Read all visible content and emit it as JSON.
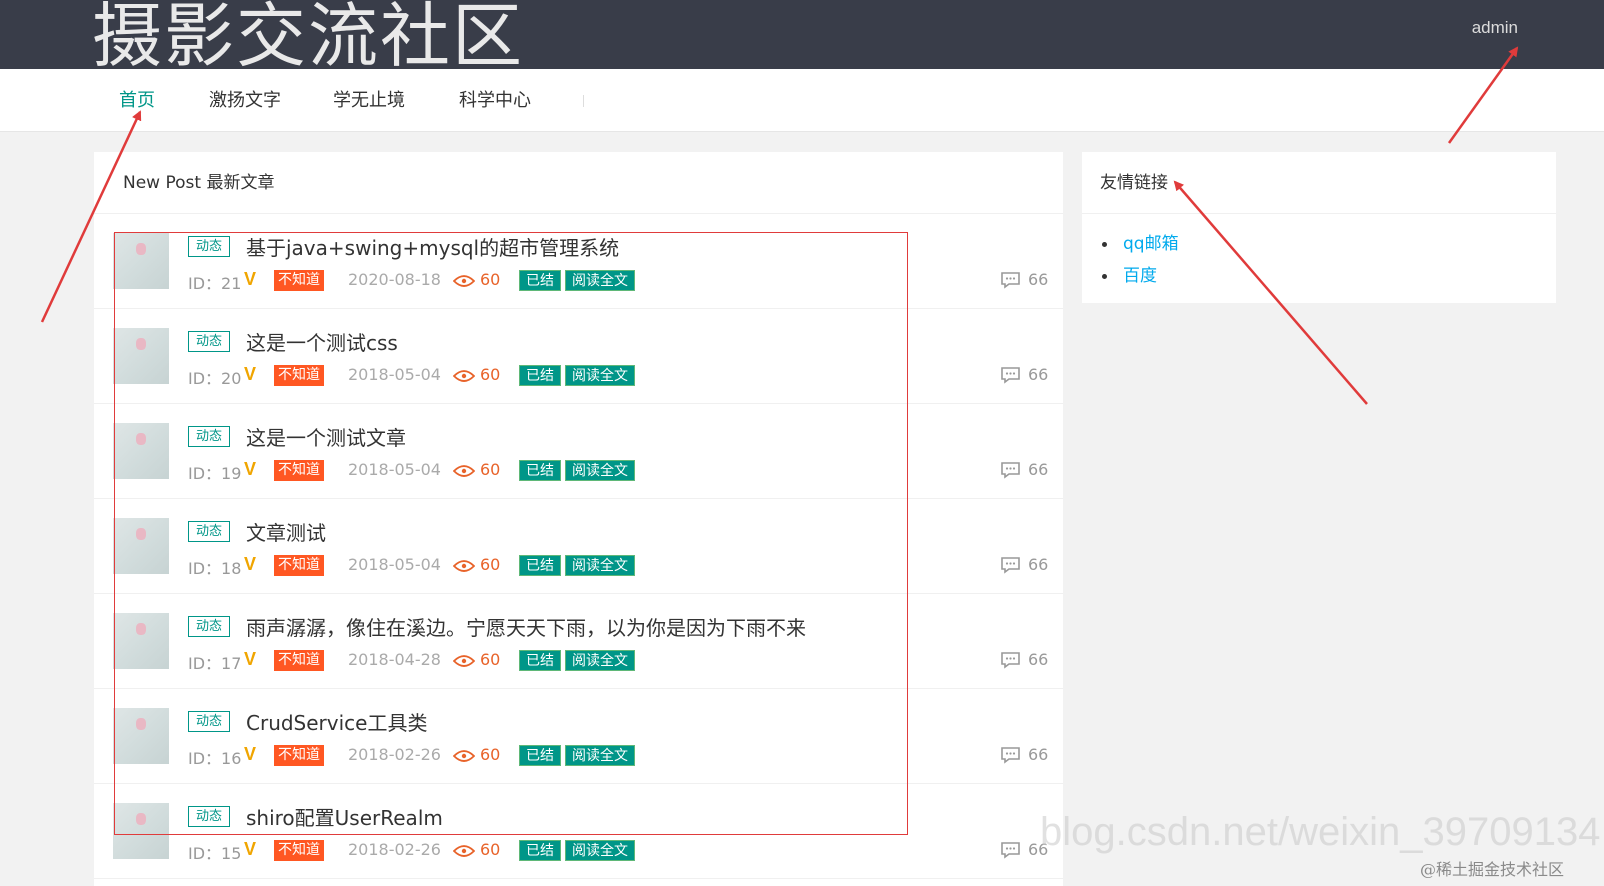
{
  "header": {
    "site_title": "摄影交流社区",
    "user": "admin"
  },
  "nav": {
    "items": [
      {
        "label": "首页",
        "active": true
      },
      {
        "label": "激扬文字"
      },
      {
        "label": "学无止境"
      },
      {
        "label": "科学中心"
      }
    ]
  },
  "main": {
    "heading": "New Post 最新文章",
    "posts": [
      {
        "tag": "动态",
        "title": "基于java+swing+mysql的超市管理系统",
        "id_label": "ID：21",
        "badge": "不知道",
        "date": "2020-08-18",
        "views": "60",
        "status": "已结",
        "read_more": "阅读全文",
        "comments": "66"
      },
      {
        "tag": "动态",
        "title": "这是一个测试css",
        "id_label": "ID：20",
        "badge": "不知道",
        "date": "2018-05-04",
        "views": "60",
        "status": "已结",
        "read_more": "阅读全文",
        "comments": "66"
      },
      {
        "tag": "动态",
        "title": "这是一个测试文章",
        "id_label": "ID：19",
        "badge": "不知道",
        "date": "2018-05-04",
        "views": "60",
        "status": "已结",
        "read_more": "阅读全文",
        "comments": "66"
      },
      {
        "tag": "动态",
        "title": "文章测试",
        "id_label": "ID：18",
        "badge": "不知道",
        "date": "2018-05-04",
        "views": "60",
        "status": "已结",
        "read_more": "阅读全文",
        "comments": "66"
      },
      {
        "tag": "动态",
        "title": "雨声潺潺，像住在溪边。宁愿天天下雨，以为你是因为下雨不来",
        "id_label": "ID：17",
        "badge": "不知道",
        "date": "2018-04-28",
        "views": "60",
        "status": "已结",
        "read_more": "阅读全文",
        "comments": "66"
      },
      {
        "tag": "动态",
        "title": "CrudService工具类",
        "id_label": "ID：16",
        "badge": "不知道",
        "date": "2018-02-26",
        "views": "60",
        "status": "已结",
        "read_more": "阅读全文",
        "comments": "66"
      },
      {
        "tag": "动态",
        "title": "shiro配置UserRealm",
        "id_label": "ID：15",
        "badge": "不知道",
        "date": "2018-02-26",
        "views": "60",
        "status": "已结",
        "read_more": "阅读全文",
        "comments": "66"
      }
    ]
  },
  "sidebar": {
    "heading": "友情链接",
    "links": [
      "qq邮箱",
      "百度"
    ]
  },
  "watermark": {
    "url": "blog.csdn.net/weixin_39709134",
    "tag": "@稀土掘金技术社区"
  },
  "colors": {
    "topbar": "#393d49",
    "accent": "#009688",
    "orange": "#ff5722",
    "link": "#01aaed",
    "annotation": "#e03b3b"
  }
}
